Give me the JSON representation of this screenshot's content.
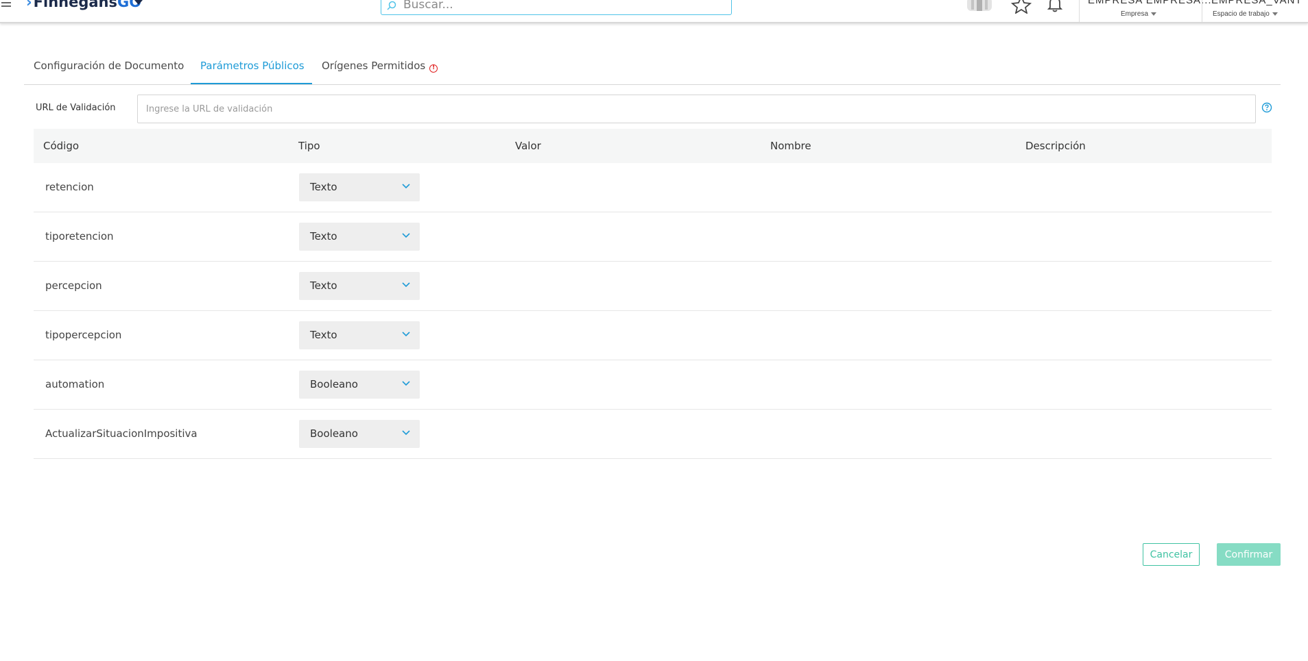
{
  "header": {
    "logo_brand": "Finnegans",
    "logo_suffix": "GO",
    "search_placeholder": "Buscar...",
    "company_value": "EMPRESA EMPRESA...",
    "company_label": "Empresa",
    "workspace_value": "EMPRESA_VANT",
    "workspace_label": "Espacio de trabajo"
  },
  "tabs": [
    {
      "label": "Configuración de Documento",
      "active": false
    },
    {
      "label": "Parámetros Públicos",
      "active": true
    },
    {
      "label": "Orígenes Permitidos",
      "active": false,
      "warning": "!"
    }
  ],
  "url_field": {
    "label": "URL de Validación",
    "value": "",
    "placeholder": "Ingrese la URL de validación"
  },
  "table": {
    "columns": [
      "Código",
      "Tipo",
      "Valor",
      "Nombre",
      "Descripción"
    ],
    "rows": [
      {
        "code": "retencion",
        "type": "Texto"
      },
      {
        "code": "tiporetencion",
        "type": "Texto"
      },
      {
        "code": "percepcion",
        "type": "Texto"
      },
      {
        "code": "tipopercepcion",
        "type": "Texto"
      },
      {
        "code": "automation",
        "type": "Booleano"
      },
      {
        "code": "ActualizarSituacionImpositiva",
        "type": "Booleano"
      }
    ]
  },
  "actions": {
    "cancel_label": "Cancelar",
    "confirm_label": "Confirmar"
  },
  "colors": {
    "accent": "#1e9bd7",
    "cancel": "#3fc2a2",
    "confirm_disabled": "#86dcc4",
    "warning": "#e02020"
  }
}
